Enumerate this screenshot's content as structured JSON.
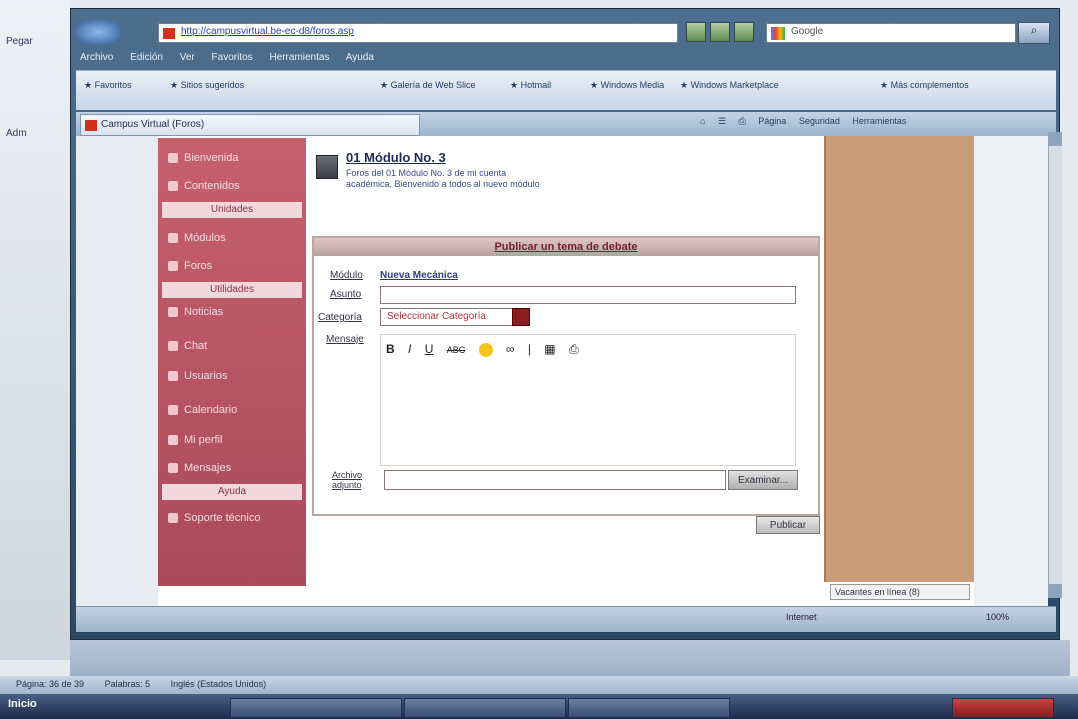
{
  "word": {
    "left_tab_1": "Pegar",
    "left_tab_2": "Adm",
    "status": [
      "Página: 36 de 39",
      "Palabras: 5",
      "Inglés (Estados Unidos)"
    ],
    "taskbar_start": "Inicio"
  },
  "browser": {
    "address": "http://campusvirtual.be-ec-d8/foros.asp",
    "search_placeholder": "Google",
    "search_icon": "magnifier-icon",
    "menu": [
      "Archivo",
      "Edición",
      "Ver",
      "Favoritos",
      "Herramientas",
      "Ayuda"
    ],
    "favorites": [
      "Favoritos",
      "Sitios sugeridos",
      "Galería de Web Slice",
      "Hotmail",
      "Windows Media",
      "Windows Marketplace",
      "Más complementos"
    ],
    "tab_title": "Campus Virtual (Foros)",
    "page_tools": [
      "Página",
      "Seguridad",
      "Herramientas"
    ],
    "status_internet": "Internet",
    "status_zoom": "100%",
    "popup_notice": "Vacantes en línea (8)"
  },
  "sidebar": {
    "items_top": [
      "Bienvenida",
      "Contenidos"
    ],
    "head_1": "Unidades",
    "items_mid": [
      "Módulos",
      "Foros"
    ],
    "head_2": "Utilidades",
    "items_low": [
      "Noticias",
      "Chat",
      "Usuarios",
      "Calendario",
      "Mi perfil",
      "Mensajes"
    ],
    "head_3": "Ayuda",
    "items_end": [
      "Soporte técnico"
    ]
  },
  "module": {
    "title": "01 Módulo No. 3",
    "desc": "Foros del 01 Módulo No. 3 de mi cuenta académica. Bienvenido a todos al nuevo módulo"
  },
  "form": {
    "header": "Publicar un tema de debate",
    "modulo_label": "Módulo",
    "modulo_value": "Nueva Mecánica",
    "asunto_label": "Asunto",
    "categoria_label": "Categoría",
    "categoria_value": "Seleccionar Categoría",
    "mensaje_label": "Mensaje",
    "toolbar": [
      "B",
      "I",
      "U",
      "ABC",
      "☺",
      "∞",
      "|",
      "▦",
      "⎙"
    ],
    "adjunto_label": "Archivo adjunto",
    "browse_button": "Examinar...",
    "publish_button": "Publicar"
  },
  "colors": {
    "sidebar": "#b85565",
    "right_panel": "#c99d7a",
    "browser_frame": "#3c5a78"
  }
}
